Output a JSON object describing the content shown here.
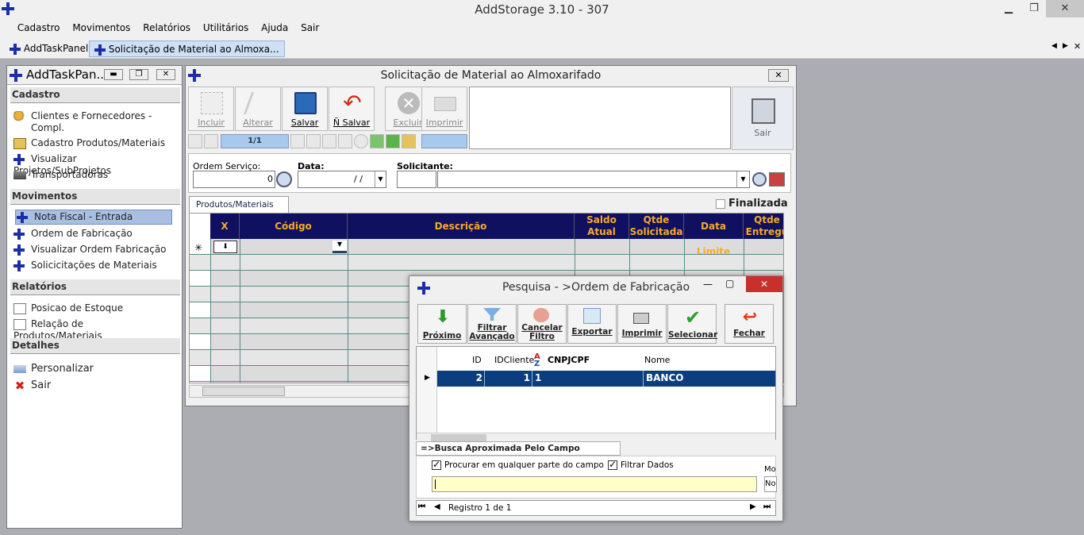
{
  "app": {
    "title": "AddStorage 3.10 - 307"
  },
  "menu": [
    "Cadastro",
    "Movimentos",
    "Relatórios",
    "Utilitários",
    "Ajuda",
    "Sair"
  ],
  "tabs": [
    {
      "label": "AddTaskPanel"
    },
    {
      "label": "Solicitação de Material ao Almoxa..."
    }
  ],
  "tabbar_nav": {
    "prev": "◀",
    "next": "▶",
    "close": "✕"
  },
  "panel": {
    "title": "AddTaskPan...",
    "sections": [
      {
        "label": "Cadastro",
        "items": [
          "Clientes e Fornecedores - Compl.",
          "Cadastro Produtos/Materiais",
          "Visualizar Projetos/SubProjetos",
          "Transportadoras"
        ]
      },
      {
        "label": "Movimentos",
        "items": [
          "Nota Fiscal  - Entrada",
          "Ordem de Fabricação",
          "Visualizar Ordem Fabricação",
          "Solicicitações de Materiais"
        ]
      },
      {
        "label": "Relatórios",
        "items": [
          "Posicao de Estoque",
          "Relação de Produtos/Materiais"
        ]
      },
      {
        "label": "Detalhes",
        "items": [
          "Personalizar",
          "Sair"
        ]
      }
    ]
  },
  "mainwin": {
    "title": "Solicitação de Material ao Almoxarifado",
    "toolbar": {
      "incluir": "Incluir",
      "alterar": "Alterar",
      "salvar": "Salvar",
      "nsalvar": "Ñ Salvar",
      "excluir": "Excluir",
      "imprimir": "Imprimir",
      "sair": "Sair"
    },
    "record_nav": "1/1",
    "fields": {
      "ordem_label": "Ordem Serviço:",
      "ordem_value": "0",
      "data_label": "Data:",
      "data_value": "/ /",
      "solicitante_label": "Solicitante:"
    },
    "subtab": "Produtos/Materiais",
    "finalizada": "Finalizada",
    "grid_headers": [
      "X",
      "Código",
      "Descrição",
      "Saldo Atual",
      "Qtde Solicitada",
      "Data Limite",
      "Qtde Entregu"
    ],
    "new_row_marker": "✳"
  },
  "popup": {
    "title": "Pesquisa - >Ordem de Fabricação",
    "buttons": {
      "proximo": "Próximo",
      "filtrar": "Filtrar Avançado",
      "cancelar": "Cancelar Filtro",
      "exportar": "Exportar",
      "imprimir": "Imprimir",
      "selecionar": "Selecionar",
      "fechar": "Fechar"
    },
    "columns": [
      "ID",
      "IDCliente",
      "CNPJCPF",
      "Nome"
    ],
    "row": {
      "id": "2",
      "idcliente": "1",
      "cnpjcpf": "1",
      "nome": "BANCO"
    },
    "search_tab": "=>Busca Aproximada Pelo Campo [CNPJCPF]",
    "opt_procurar": "Procurar em qualquer parte do campo",
    "opt_filtrar": "Filtrar Dados",
    "mo_label": "Mo",
    "mo_value": "No",
    "registro": "Registro 1 de 1"
  },
  "colors": {
    "accent": "#1a2ea8",
    "grid_header_bg": "#101060",
    "grid_header_fg": "#f7a928",
    "selected_row": "#0a3e7e",
    "search_bg": "#ffffc8"
  }
}
